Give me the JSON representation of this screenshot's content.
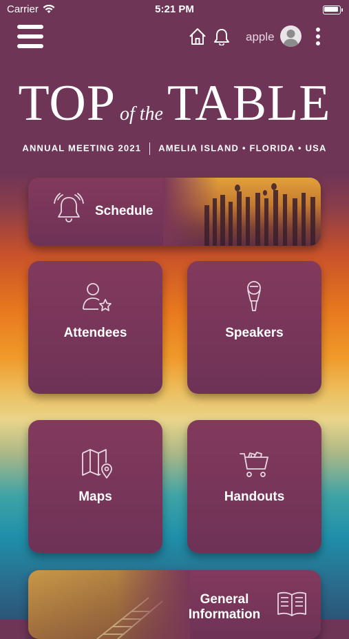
{
  "status_bar": {
    "carrier": "Carrier",
    "time": "5:21 PM"
  },
  "nav": {
    "user_name": "apple"
  },
  "header": {
    "logo_top": "TOP",
    "logo_mid": "of the",
    "logo_table": "TABLE",
    "subtitle_left": "ANNUAL MEETING 2021",
    "subtitle_right": "AMELIA ISLAND • FLORIDA • USA"
  },
  "tiles": {
    "schedule": "Schedule",
    "attendees": "Attendees",
    "speakers": "Speakers",
    "maps": "Maps",
    "handouts": "Handouts",
    "general_info_line1": "General",
    "general_info_line2": "Information"
  },
  "colors": {
    "brand": "#6e3557",
    "tile": "#7a3758"
  }
}
